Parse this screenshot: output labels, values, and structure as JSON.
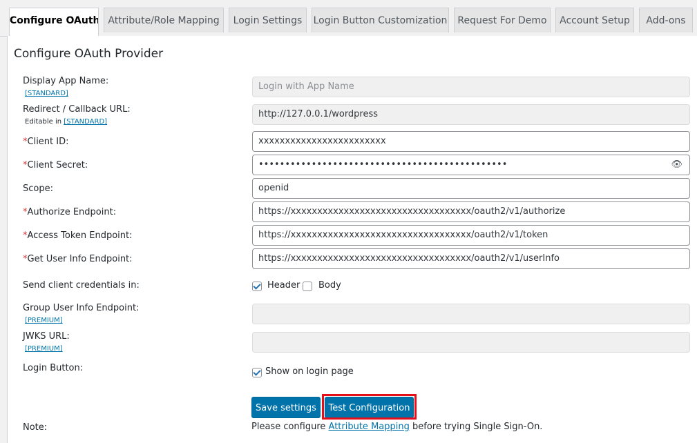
{
  "tabs": [
    {
      "label": "Configure OAuth",
      "active": true
    },
    {
      "label": "Attribute/Role Mapping",
      "active": false
    },
    {
      "label": "Login Settings",
      "active": false
    },
    {
      "label": "Login Button Customization",
      "active": false
    },
    {
      "label": "Request For Demo",
      "active": false
    },
    {
      "label": "Account Setup",
      "active": false
    },
    {
      "label": "Add-ons",
      "active": false
    }
  ],
  "panel": {
    "title": "Configure OAuth Provider"
  },
  "fields": {
    "display_app_name": {
      "label": "Display App Name:",
      "sub": "[STANDARD]",
      "placeholder": "Login with App Name"
    },
    "redirect_url": {
      "label": "Redirect / Callback URL:",
      "sub_prefix": "Editable in ",
      "sub_link": "[STANDARD]",
      "value": "http://127.0.0.1/wordpress"
    },
    "client_id": {
      "label": "Client ID:",
      "required": "*",
      "value": "xxxxxxxxxxxxxxxxxxxxxxxx"
    },
    "client_secret": {
      "label": "Client Secret:",
      "required": "*",
      "value": "•••••••••••••••••••••••••••••••••••••••••••••••",
      "icon": "eye-icon"
    },
    "scope": {
      "label": "Scope:",
      "value": "openid"
    },
    "authorize_endpoint": {
      "label": "Authorize Endpoint:",
      "required": "*",
      "value": "https://xxxxxxxxxxxxxxxxxxxxxxxxxxxxxxxxxx/oauth2/v1/authorize"
    },
    "access_token_endpoint": {
      "label": "Access Token Endpoint:",
      "required": "*",
      "value": "https://xxxxxxxxxxxxxxxxxxxxxxxxxxxxxxxxxx/oauth2/v1/token"
    },
    "user_info_endpoint": {
      "label": "Get User Info Endpoint:",
      "required": "*",
      "value": "https://xxxxxxxxxxxxxxxxxxxxxxxxxxxxxxxxxx/oauth2/v1/userInfo"
    },
    "send_credentials": {
      "label": "Send client credentials in:",
      "options": [
        {
          "label": "Header",
          "checked": true
        },
        {
          "label": "Body",
          "checked": false
        }
      ]
    },
    "group_user_info": {
      "label": "Group User Info Endpoint:",
      "sub": "[PREMIUM]",
      "value": ""
    },
    "jwks_url": {
      "label": "JWKS URL:",
      "sub": "[PREMIUM]",
      "value": ""
    },
    "login_button": {
      "label": "Login Button:",
      "option": "Show on login page",
      "checked": true
    }
  },
  "buttons": {
    "save": "Save settings",
    "test": "Test Configuration"
  },
  "note": {
    "label": "Note:",
    "prefix": "Please configure ",
    "link": "Attribute Mapping",
    "suffix": " before trying Single Sign-On."
  },
  "colors": {
    "primary": "#0073aa",
    "highlight": "#e3101c",
    "required": "#d63638"
  }
}
